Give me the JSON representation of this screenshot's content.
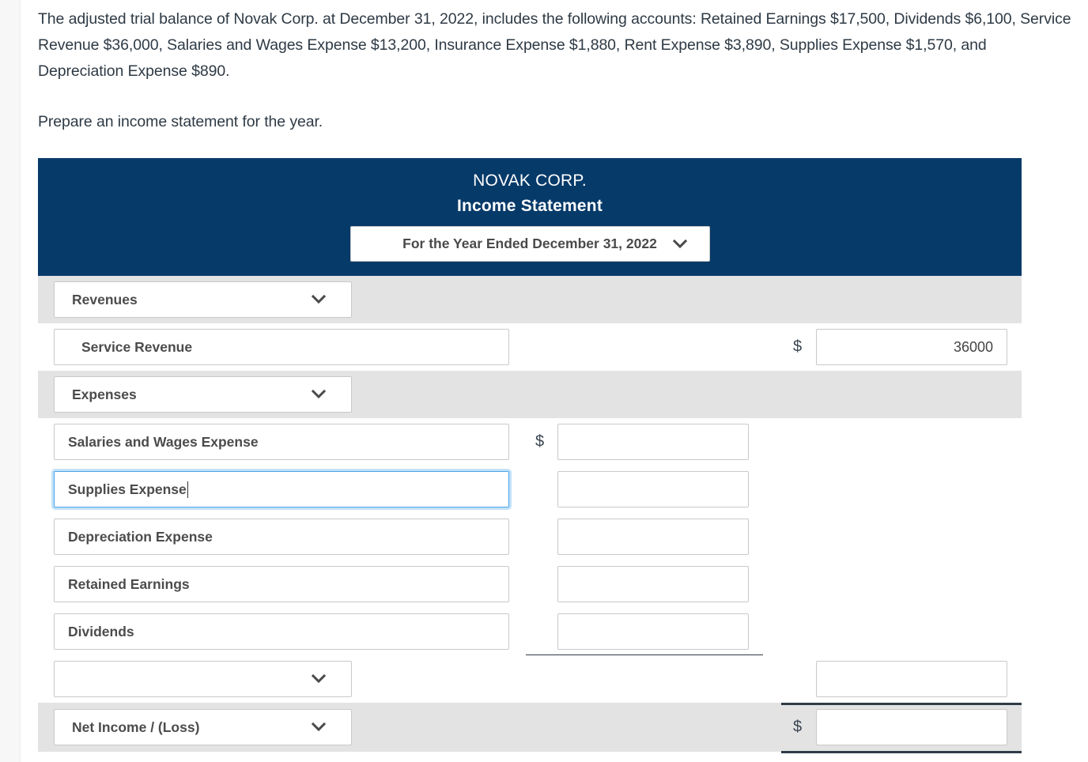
{
  "prompt": {
    "paragraph1": "The adjusted trial balance of Novak Corp. at December 31, 2022, includes the following accounts: Retained Earnings $17,500, Dividends $6,100, Service Revenue $36,000, Salaries and Wages Expense $13,200, Insurance Expense $1,880, Rent Expense $3,890, Supplies Expense $1,570, and Depreciation Expense $890.",
    "paragraph2": "Prepare an income statement for the year."
  },
  "statement": {
    "company_name": "NOVAK CORP.",
    "title": "Income Statement",
    "period": "For the Year Ended December 31, 2022",
    "header_color": "#063a69",
    "shaded_row_color": "#e3e3e3",
    "focus_border_color": "#4ea4e8",
    "rule_color": "#2f3b47",
    "currency_symbol": "$",
    "rows": [
      {
        "name": "revenues-section",
        "type": "select",
        "label": "Revenues",
        "shaded": true
      },
      {
        "name": "service-revenue",
        "type": "line-item",
        "label": "Service Revenue",
        "indent": true,
        "amount": "36000",
        "amount_column": "right",
        "show_dollar": true
      },
      {
        "name": "expenses-section",
        "type": "select",
        "label": "Expenses",
        "shaded": true
      },
      {
        "name": "salaries-and-wages-expense",
        "type": "line-item",
        "label": "Salaries and Wages Expense",
        "amount": "",
        "amount_column": "middle",
        "show_dollar": true
      },
      {
        "name": "supplies-expense",
        "type": "line-item",
        "label": "Supplies Expense",
        "amount": "",
        "amount_column": "middle",
        "focused": true
      },
      {
        "name": "depreciation-expense",
        "type": "line-item",
        "label": "Depreciation Expense",
        "amount": "",
        "amount_column": "middle"
      },
      {
        "name": "retained-earnings",
        "type": "line-item",
        "label": "Retained Earnings",
        "amount": "",
        "amount_column": "middle"
      },
      {
        "name": "dividends",
        "type": "line-item",
        "label": "Dividends",
        "amount": "",
        "amount_column": "middle"
      },
      {
        "name": "total-expenses",
        "type": "select",
        "label": "",
        "amount": "",
        "amount_column": "right"
      },
      {
        "name": "net-income-loss",
        "type": "select",
        "label": "Net Income / (Loss)",
        "shaded": true,
        "amount": "",
        "amount_column": "right",
        "show_dollar": true
      }
    ]
  },
  "icons": {
    "chevron_down": "chevron-down-icon"
  }
}
